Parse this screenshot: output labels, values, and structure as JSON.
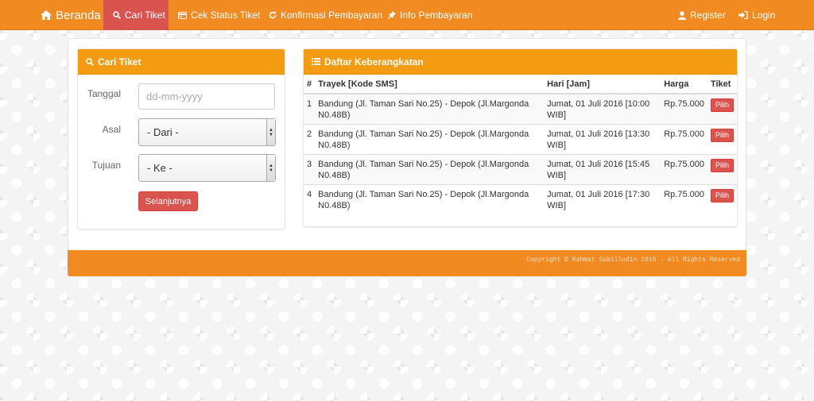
{
  "nav": {
    "brand": "Beranda",
    "items": [
      {
        "label": "Cari Tiket"
      },
      {
        "label": "Cek Status Tiket"
      },
      {
        "label": "Konfirmasi Pembayaran"
      },
      {
        "label": "Info Pembayaran"
      }
    ],
    "register": "Register",
    "login": "Login"
  },
  "search_panel": {
    "title": "Cari Tiket",
    "tanggal_label": "Tanggal",
    "tanggal_placeholder": "dd-mm-yyyy",
    "asal_label": "Asal",
    "asal_value": "- Dari -",
    "tujuan_label": "Tujuan",
    "tujuan_value": "- Ke -",
    "next_button": "Selanjutnya"
  },
  "departure_panel": {
    "title": "Daftar Keberangkatan",
    "columns": [
      "#",
      "Trayek [Kode SMS]",
      "Hari [Jam]",
      "Harga",
      "Tiket"
    ],
    "rows": [
      {
        "no": "1",
        "route_line1": "Bandung (Jl. Taman Sari No.25) - Depok (Jl.Margonda",
        "route_line2": "N0.48B)",
        "day_line1": "Jumat, 01 Juli 2016 [10:00",
        "day_line2": "WIB]",
        "price": "Rp.75.000",
        "action": "Pilih"
      },
      {
        "no": "2",
        "route_line1": "Bandung (Jl. Taman Sari No.25) - Depok (Jl.Margonda",
        "route_line2": "N0.48B)",
        "day_line1": "Jumat, 01 Juli 2016 [13:30",
        "day_line2": "WIB]",
        "price": "Rp.75.000",
        "action": "Pilih"
      },
      {
        "no": "3",
        "route_line1": "Bandung (Jl. Taman Sari No.25) - Depok (Jl.Margonda",
        "route_line2": "N0.48B)",
        "day_line1": "Jumat, 01 Juli 2016 [15:45",
        "day_line2": "WIB]",
        "price": "Rp.75.000",
        "action": "Pilih"
      },
      {
        "no": "4",
        "route_line1": "Bandung (Jl. Taman Sari No.25) - Depok (Jl.Margonda",
        "route_line2": "N0.48B)",
        "day_line1": "Jumat, 01 Juli 2016 [17:30",
        "day_line2": "WIB]",
        "price": "Rp.75.000",
        "action": "Pilih"
      }
    ]
  },
  "footer": {
    "copyright": "Copyright © Rahmat Sabilludin 2016 . All Rights Reserved"
  },
  "colors": {
    "navbar": "#f18a21",
    "panel_heading": "#f39c12",
    "danger": "#d9534f"
  },
  "icons": [
    "home-icon",
    "search-icon",
    "card-icon",
    "refresh-icon",
    "pin-icon",
    "user-icon",
    "login-icon",
    "list-icon"
  ]
}
